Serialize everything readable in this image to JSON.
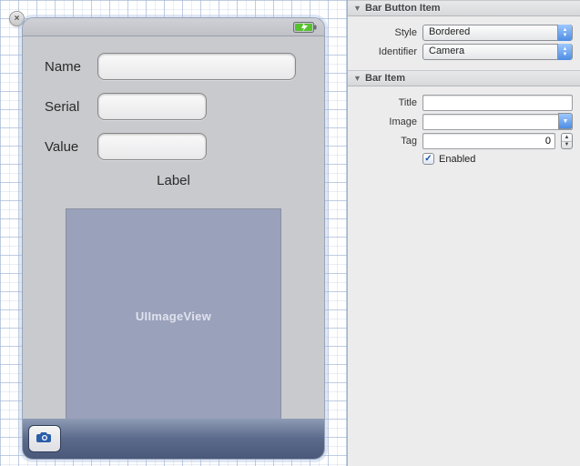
{
  "device": {
    "fields": {
      "name_label": "Name",
      "serial_label": "Serial",
      "value_label": "Value"
    },
    "label_text": "Label",
    "imageview_placeholder": "UIImageView",
    "toolbar": {
      "camera_button": "camera"
    }
  },
  "inspector": {
    "section_bar_button_item": "Bar Button Item",
    "section_bar_item": "Bar Item",
    "bar_button_item": {
      "style_label": "Style",
      "style_value": "Bordered",
      "identifier_label": "Identifier",
      "identifier_value": "Camera"
    },
    "bar_item": {
      "title_label": "Title",
      "title_value": "",
      "image_label": "Image",
      "image_value": "",
      "tag_label": "Tag",
      "tag_value": "0",
      "enabled_label": "Enabled",
      "enabled_checked": true
    }
  }
}
